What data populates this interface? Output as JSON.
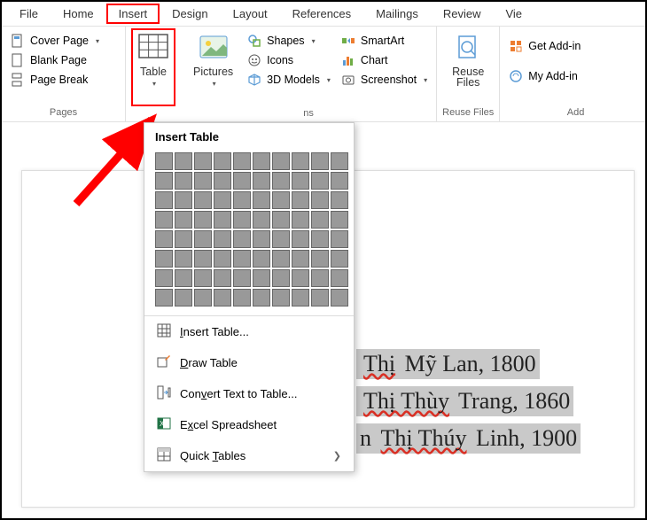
{
  "tabs": {
    "file": "File",
    "home": "Home",
    "insert": "Insert",
    "design": "Design",
    "layout": "Layout",
    "references": "References",
    "mailings": "Mailings",
    "review": "Review",
    "view": "Vie"
  },
  "pages": {
    "cover": "Cover Page",
    "blank": "Blank Page",
    "break": "Page Break",
    "group": "Pages"
  },
  "table": {
    "label": "Table"
  },
  "pictures": {
    "label": "Pictures"
  },
  "illus": {
    "shapes": "Shapes",
    "icons": "Icons",
    "models": "3D Models",
    "smartart": "SmartArt",
    "chart": "Chart",
    "screenshot": "Screenshot",
    "group": "ns"
  },
  "reuse": {
    "label": "Reuse",
    "label2": "Files",
    "group": "Reuse Files"
  },
  "addins": {
    "get": "Get Add-in",
    "my": "My Add-in",
    "group": "Add"
  },
  "dropdown": {
    "title": "Insert Table",
    "grid_cols": 10,
    "grid_rows": 8,
    "insert": "Insert Table...",
    "draw": "Draw Table",
    "convert": "Convert Text to Table...",
    "excel": "Excel Spreadsheet",
    "quick": "Quick Tables",
    "keys": {
      "insert": "I",
      "draw": "D",
      "convert": "v",
      "excel": "x",
      "quick": "T"
    }
  },
  "doc": {
    "line1": " Thị Mỹ Lan, 1800",
    "line2": " Thị Thùy Trang, 1860",
    "line3": "n Thị Thúy Linh, 1900"
  }
}
